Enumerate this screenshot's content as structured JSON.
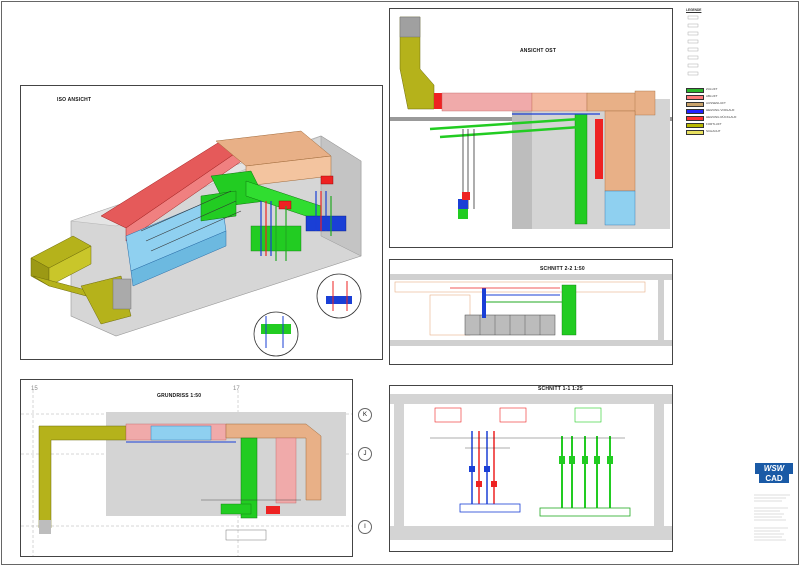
{
  "views": {
    "iso_title": "ISO ANSICHT",
    "east_title": "ANSICHT OST",
    "section22_title": "SCHNITT 2-2  1:50",
    "section11_title": "SCHNITT 1-1  1:25",
    "plan_title": "GRUNDRISS  1:50"
  },
  "grid_labels": {
    "axis_15": "15",
    "axis_17": "17",
    "axis_k": "K",
    "axis_j": "J",
    "axis_i": "I"
  },
  "legend": {
    "heading": "LEGENDE",
    "items": [
      {
        "label": "ZULUFT",
        "color": "#2bb52b"
      },
      {
        "label": "ABLUFT",
        "color": "#ff7a7a"
      },
      {
        "label": "AUSSENLUFT",
        "color": "#c8a26b"
      },
      {
        "label": "HEIZUNG VORLAUF",
        "color": "#2222ff"
      },
      {
        "label": "HEIZUNG RÜCKLAUF",
        "color": "#ff3030"
      },
      {
        "label": "FORTLUFT",
        "color": "#b8b800"
      },
      {
        "label": "SCHACHT",
        "color": "#e8e060"
      }
    ]
  },
  "logo": {
    "line1": "WSW",
    "line2": "CAD"
  },
  "colors": {
    "olive": "#b5b21b",
    "red": "#e55a5a",
    "peach": "#e8b087",
    "green": "#22cc22",
    "blue": "#8fd0f0",
    "darkblue": "#1a3fd6",
    "wall": "#cfcfcf"
  }
}
